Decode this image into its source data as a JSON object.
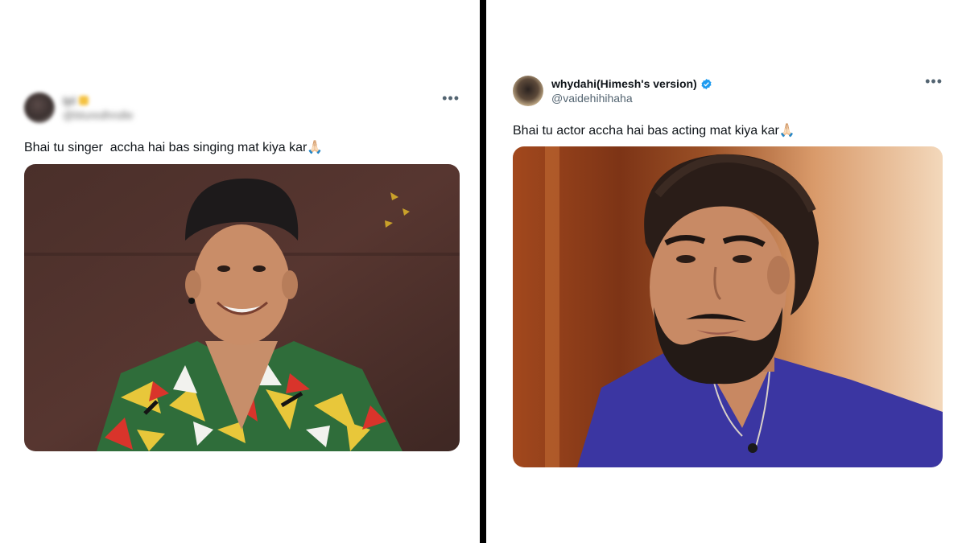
{
  "left_tweet": {
    "display_name": "Ipl",
    "handle": "@bluredhndle",
    "text": "Bhai tu singer  accha hai bas singing mat kiya kar",
    "emoji": "🙏🏻",
    "more_icon": "more-horizontal-icon"
  },
  "right_tweet": {
    "display_name": "whydahi(Himesh's version)",
    "handle": "@vaidehihihaha",
    "text": "Bhai tu actor accha hai bas acting mat kiya kar",
    "emoji": "🙏🏻",
    "verified_icon": "verified-badge-icon",
    "more_icon": "more-horizontal-icon"
  },
  "colors": {
    "text": "#0f1419",
    "secondary": "#536471",
    "verified": "#1d9bf0",
    "divider": "#000000"
  }
}
